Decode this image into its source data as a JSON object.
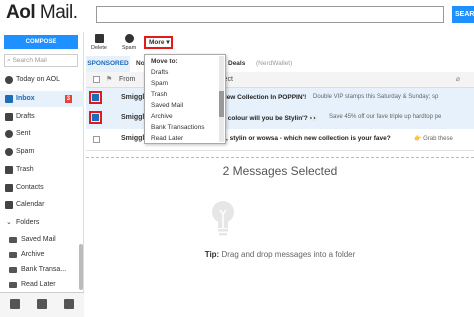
{
  "header": {
    "logo_bold": "Aol",
    "logo_thin": " Mail.",
    "search_button": "SEAR"
  },
  "sidebar": {
    "compose": "COMPOSE",
    "search_placeholder": "Search Mail",
    "items": [
      {
        "label": "Today on AOL"
      },
      {
        "label": "Inbox",
        "badge": "3"
      },
      {
        "label": "Drafts"
      },
      {
        "label": "Sent"
      },
      {
        "label": "Spam"
      },
      {
        "label": "Trash"
      },
      {
        "label": "Contacts"
      },
      {
        "label": "Calendar"
      },
      {
        "label": "Folders"
      },
      {
        "label": "Saved Mail"
      },
      {
        "label": "Archive"
      },
      {
        "label": "Bank Transa..."
      },
      {
        "label": "Read Later"
      }
    ]
  },
  "toolbar": {
    "delete": "Delete",
    "spam": "Spam",
    "more": "More ▾"
  },
  "tabs": {
    "sponsored": "SPONSORED",
    "no": "No",
    "deals": "Deals",
    "nerd": "(NerdWallet)"
  },
  "columns": {
    "from": "From",
    "subject": "ject"
  },
  "messages": [
    {
      "sender": "Smiggle",
      "subject": "New Collection In POPPIN'!",
      "preview": "Double VIP stamps this Saturday & Sunday; sp"
    },
    {
      "sender": "Smiggle",
      "subject": "h colour will you be Stylin'? 👀",
      "preview": "Save 45% off our fave triple up hardtop pe"
    },
    {
      "sender": "Smiggle",
      "subject": "n, stylin or wowsa - which new collection is your fave?",
      "preview": "👉 Grab these"
    }
  ],
  "dropdown": {
    "title": "Move to:",
    "items": [
      "Drafts",
      "Spam",
      "Trash",
      "Saved Mail",
      "Archive",
      "Bank Transactions",
      "Read Later"
    ]
  },
  "preview_pane": {
    "title": "2 Messages Selected",
    "tip_label": "Tip:",
    "tip_text": " Drag and drop messages into a folder"
  },
  "colors": {
    "accent": "#1e90ff",
    "highlight": "#e21a1a",
    "selected_row": "#e6f1fb",
    "badge": "#e8433a"
  }
}
